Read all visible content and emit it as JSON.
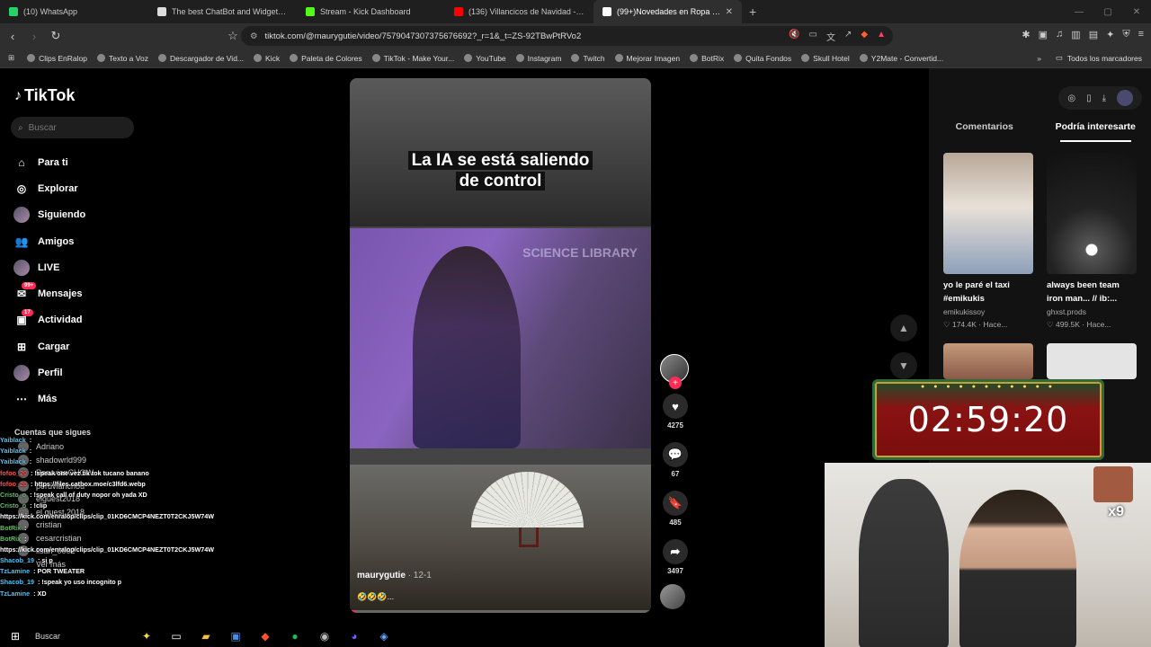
{
  "browser": {
    "tabs": [
      {
        "title": "(10) WhatsApp",
        "color": "#25d366",
        "active": false
      },
      {
        "title": "The best ChatBot and Widgets for Ki",
        "color": "#dddddd",
        "active": false
      },
      {
        "title": "Stream - Kick Dashboard",
        "color": "#53fc18",
        "active": false
      },
      {
        "title": "(136) Villancicos de Navidad - Lo",
        "color": "#ff0000",
        "active": false
      },
      {
        "title": "(99+)Novedades en Ropa de Pa",
        "color": "#ffffff",
        "active": true
      }
    ],
    "new_tab": "+",
    "url": "tiktok.com/@maurygutie/video/7579047307375676692?_r=1&_t=ZS-92TBwPtRVo2",
    "bookmarks": [
      "Clips EnRalop",
      "Texto a Voz",
      "Descargador de Vid...",
      "Kick",
      "Paleta de Colores",
      "TikTok - Make Your...",
      "YouTube",
      "Instagram",
      "Twitch",
      "Mejorar Imagen",
      "BotRix",
      "Quita Fondos",
      "Skull Hotel",
      "Y2Mate - Convertid..."
    ],
    "bookmarks_all": "Todos los marcadores"
  },
  "tiktok": {
    "logo": "TikTok",
    "search_placeholder": "Buscar",
    "menu": [
      {
        "label": "Para ti",
        "icon": "home-icon",
        "glyph": "⌂"
      },
      {
        "label": "Explorar",
        "icon": "compass-icon",
        "glyph": "◎"
      },
      {
        "label": "Siguiendo",
        "icon": "following-avatar-icon",
        "glyph": ""
      },
      {
        "label": "Amigos",
        "icon": "friends-icon",
        "glyph": "👥"
      },
      {
        "label": "LIVE",
        "icon": "live-avatar-icon",
        "glyph": ""
      },
      {
        "label": "Mensajes",
        "icon": "messages-icon",
        "glyph": "✉",
        "badge": "99+"
      },
      {
        "label": "Actividad",
        "icon": "activity-icon",
        "glyph": "▣",
        "badge": "17"
      },
      {
        "label": "Cargar",
        "icon": "upload-icon",
        "glyph": "⊞"
      },
      {
        "label": "Perfil",
        "icon": "profile-avatar-icon",
        "glyph": ""
      },
      {
        "label": "Más",
        "icon": "more-icon",
        "glyph": "⋯"
      }
    ],
    "following_title": "Cuentas que sigues",
    "following": [
      "Adriano",
      "shadowrld999",
      "PeruvianCHOW",
      "peruvianchou",
      "elguest2018",
      "el.guest.2018",
      "cristian",
      "cesarcristian",
      "lisan_0002"
    ],
    "see_more": "Ver más"
  },
  "video": {
    "caption_line1": "La IA se está saliendo",
    "caption_line2": "de control",
    "sign_text": "SCIENCE LIBRARY",
    "author": "maurygutie",
    "date": "12-1",
    "emojis": "🤣🤣🤣...",
    "progress": 0.02
  },
  "actions": {
    "likes": "4275",
    "comments": "67",
    "saves": "485",
    "shares": "3497"
  },
  "right_panel": {
    "tabs": [
      "Comentarios",
      "Podría interesarte"
    ],
    "active_tab": 1,
    "cards": [
      {
        "caption": "yo le paré el taxi #emikukis",
        "user": "emikukissoy",
        "stats": "♡ 174.4K · Hace..."
      },
      {
        "caption": "always been team iron man... // ib:...",
        "user": "ghxst.prods",
        "stats": "♡ 499.5K · Hace..."
      }
    ]
  },
  "overlays": {
    "timer": "02:59:20",
    "cam_label": "x9",
    "chat": [
      {
        "user": "Yaiblack",
        "color": "#4fc3f7",
        "text": ""
      },
      {
        "user": "Yaiblack",
        "color": "#4fc3f7",
        "text": ""
      },
      {
        "user": "Yaiblack",
        "color": "#4fc3f7",
        "text": ""
      },
      {
        "user": "fofoo_20",
        "color": "#ff4d4d",
        "text": "!speak one vez tik tok tucano banano"
      },
      {
        "user": "fofoo_20",
        "color": "#ff4d4d",
        "text": "https://files.catbox.moe/c3lfd6.webp"
      },
      {
        "user": "Cristo_o",
        "color": "#66bb6a",
        "text": "!speak call of duty nopor oh yada XD"
      },
      {
        "user": "Cristo_o",
        "color": "#66bb6a",
        "text": "!clip"
      },
      {
        "user": "",
        "color": "#ffffff",
        "text": "https://kick.com/enralop/clips/clip_01KD6CMCP4NEZT0T2CKJ5W74W"
      },
      {
        "user": "BotRix",
        "color": "#66bb6a",
        "text": ""
      },
      {
        "user": "BotRix",
        "color": "#66bb6a",
        "text": ""
      },
      {
        "user": "",
        "color": "#ffffff",
        "text": "https://kick.com/enralop/clips/clip_01KD6CMCP4NEZT0T2CKJ5W74W"
      },
      {
        "user": "Shacob_19",
        "color": "#4fc3f7",
        "text": "si p"
      },
      {
        "user": "TzLamine",
        "color": "#4fc3f7",
        "text": "POR TWEATER"
      },
      {
        "user": "Shacob_19",
        "color": "#4fc3f7",
        "text": "!speak yo uso incognito p"
      },
      {
        "user": "TzLamine",
        "color": "#4fc3f7",
        "text": "XD"
      }
    ],
    "taskbar_search": "Buscar"
  }
}
